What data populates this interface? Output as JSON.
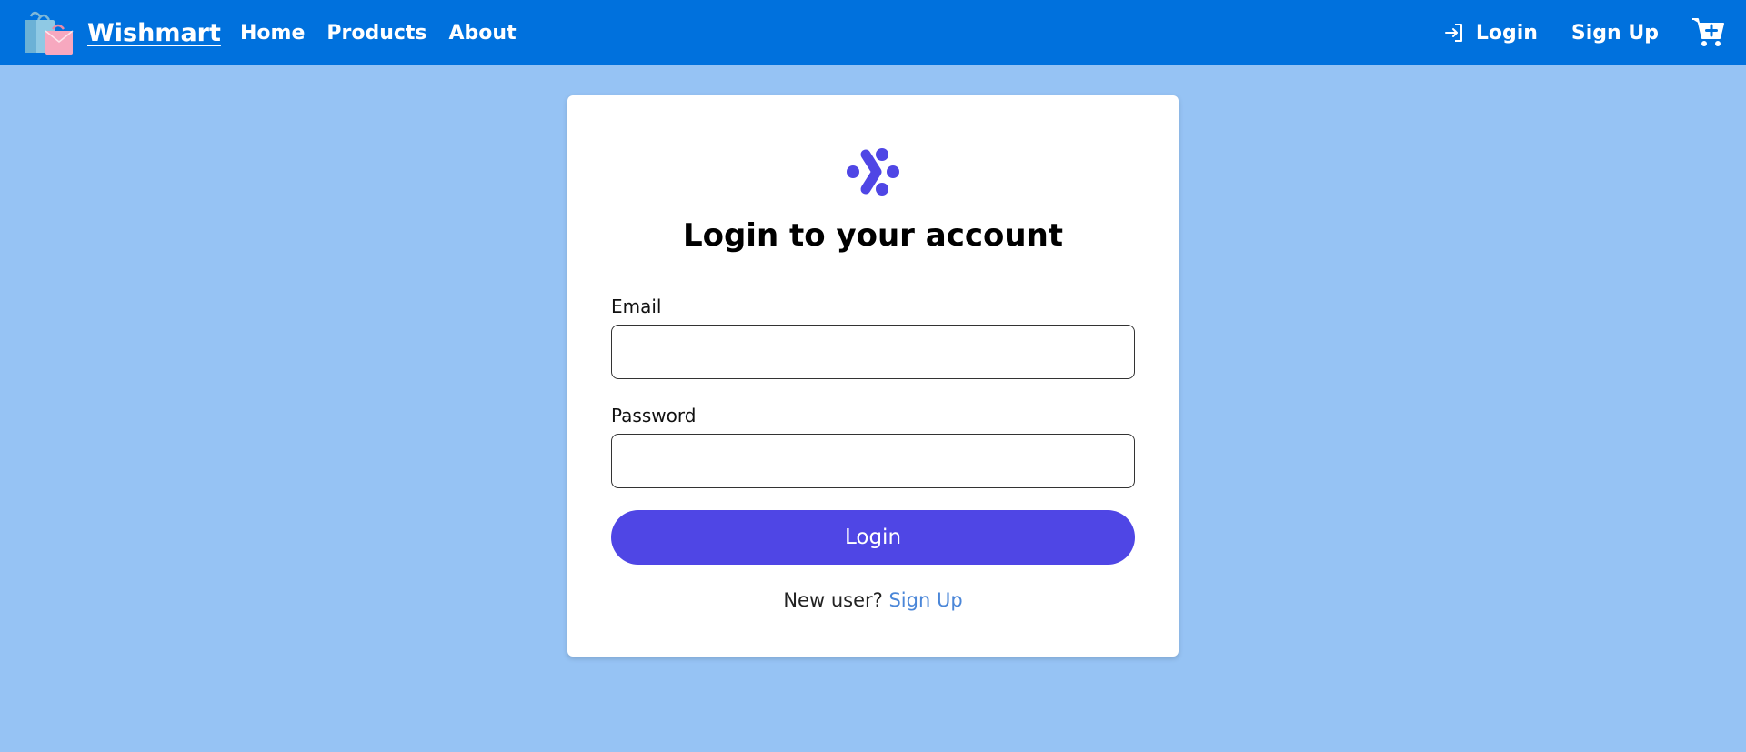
{
  "navbar": {
    "brand_name": "Wishmart",
    "brand_logo_icon": "shopping-bags-icon",
    "links": [
      "Home",
      "Products",
      "About"
    ],
    "login_label": "Login",
    "login_icon": "login-arrow-icon",
    "signup_label": "Sign Up",
    "cart_icon": "cart-plus-icon",
    "color": "#0071dd"
  },
  "login_card": {
    "logo_icon": "dots-chevron-logo-icon",
    "title": "Login to your account",
    "email_label": "Email",
    "email_value": "",
    "password_label": "Password",
    "password_value": "",
    "submit_label": "Login",
    "new_user_text": "New user?",
    "signup_link": "Sign Up",
    "accent": "#4f46e5",
    "link_color": "#4a86d8"
  },
  "page": {
    "background": "#96c3f4"
  }
}
